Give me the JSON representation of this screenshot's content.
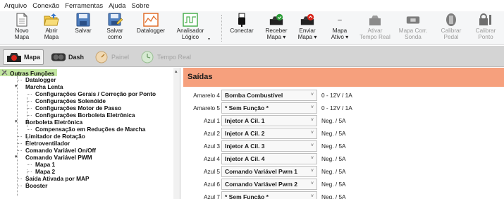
{
  "menu": [
    "Arquivo",
    "Conexão",
    "Ferramentas",
    "Ajuda",
    "Sobre"
  ],
  "toolbar": {
    "novo_mapa": "Novo\nMapa",
    "abrir_mapa": "Abrir\nMapa",
    "salvar": "Salvar",
    "salvar_como": "Salvar\ncomo",
    "datalogger": "Datalogger",
    "analisador": "Analisador\nLógico",
    "conectar": "Conectar",
    "receber_mapa": "Receber\nMapa ▾",
    "enviar_mapa": "Enviar\nMapa ▾",
    "mapa_ativo": "Mapa\nAtivo ▾",
    "mapa_ativo_value": "–",
    "ativar_tempo_real": "Ativar\nTempo Real",
    "mapa_corr_sonda": "Mapa Corr.\nSonda",
    "calibrar_pedal": "Calibrar\nPedal",
    "calibrar_ponto": "Calibrar\nPonto"
  },
  "view_tabs": {
    "mapa": "Mapa",
    "dash": "Dash",
    "painel": "Painel",
    "tempo_real": "Tempo Real"
  },
  "tree": {
    "items": [
      "Outras Funções",
      "Datalogger",
      "Marcha Lenta",
      "Configurações Gerais / Correção por Ponto",
      "Configurações Solenóide",
      "Configurações Motor de Passo",
      "Configurações Borboleta Eletrônica",
      "Borboleta Eletrônica",
      "Compensação em Reduções de Marcha",
      "Limitador de Rotação",
      "Eletroventilador",
      "Comando Variável On/Off",
      "Comando Variável PWM",
      "Mapa 1",
      "Mapa 2",
      "Saída Ativada por MAP",
      "Booster"
    ]
  },
  "main": {
    "title": "Saídas",
    "rows": [
      {
        "output": "Amarelo 4",
        "function": "Bomba Combustível",
        "range": "0 - 12V / 1A"
      },
      {
        "output": "Amarelo 5",
        "function": "* Sem Função *",
        "range": "0 - 12V / 1A"
      },
      {
        "output": "Azul 1",
        "function": "Injetor A Cil. 1",
        "range": "Neg. / 5A"
      },
      {
        "output": "Azul 2",
        "function": "Injetor A Cil. 2",
        "range": "Neg. / 5A"
      },
      {
        "output": "Azul 3",
        "function": "Injetor A Cil. 3",
        "range": "Neg. / 5A"
      },
      {
        "output": "Azul 4",
        "function": "Injetor A Cil. 4",
        "range": "Neg. / 5A"
      },
      {
        "output": "Azul 5",
        "function": "Comando Variável Pwm 1",
        "range": "Neg. / 5A"
      },
      {
        "output": "Azul 6",
        "function": "Comando Variável Pwm 2",
        "range": "Neg. / 5A"
      },
      {
        "output": "Azul 7",
        "function": "* Sem Função *",
        "range": "Neg. / 5A"
      }
    ]
  },
  "colors": {
    "header_bg": "#f6a07d",
    "tree_selected": "#c2e6a0",
    "tab_bar": "#d4d4d4",
    "receive_green": "#2e9e3a",
    "send_red": "#d9261c"
  }
}
